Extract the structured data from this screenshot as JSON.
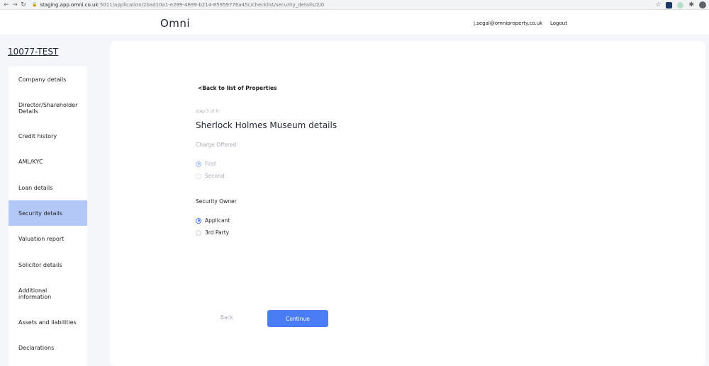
{
  "browser": {
    "url_host": "staging.app.omni.co.uk",
    "url_path": ":5011/application/2bad10a1-e289-4699-b214-85959776a45c/checklist/security_details/2/0"
  },
  "header": {
    "logo": "Omni",
    "user_email": "j.segal@omniproperty.co.uk",
    "logout_label": "Logout"
  },
  "sidebar": {
    "application_id": "10077-TEST",
    "items": [
      {
        "label": "Company details",
        "active": false
      },
      {
        "label": "Director/Shareholder Details",
        "active": false
      },
      {
        "label": "Credit history",
        "active": false
      },
      {
        "label": "AML/KYC",
        "active": false
      },
      {
        "label": "Loan details",
        "active": false
      },
      {
        "label": "Security details",
        "active": true
      },
      {
        "label": "Valuation report",
        "active": false
      },
      {
        "label": "Solicitor details",
        "active": false
      },
      {
        "label": "Additional information",
        "active": false
      },
      {
        "label": "Assets and liabilities",
        "active": false
      },
      {
        "label": "Declarations",
        "active": false
      }
    ]
  },
  "main": {
    "back_link": "<Back to list of Properties",
    "step": "step 3 of 6",
    "title": "Sherlock Holmes Museum details",
    "charge": {
      "label": "Charge Offered",
      "options": [
        {
          "label": "First",
          "selected": true
        },
        {
          "label": "Second",
          "selected": false
        }
      ]
    },
    "owner": {
      "label": "Security Owner",
      "options": [
        {
          "label": "Applicant",
          "selected": true
        },
        {
          "label": "3rd Party",
          "selected": false
        }
      ]
    },
    "back_button": "Back",
    "continue_button": "Continue"
  },
  "colors": {
    "accent": "#4a7cf6",
    "sidebar_active": "#b4c8f7",
    "page_background": "#f4f6fa"
  }
}
